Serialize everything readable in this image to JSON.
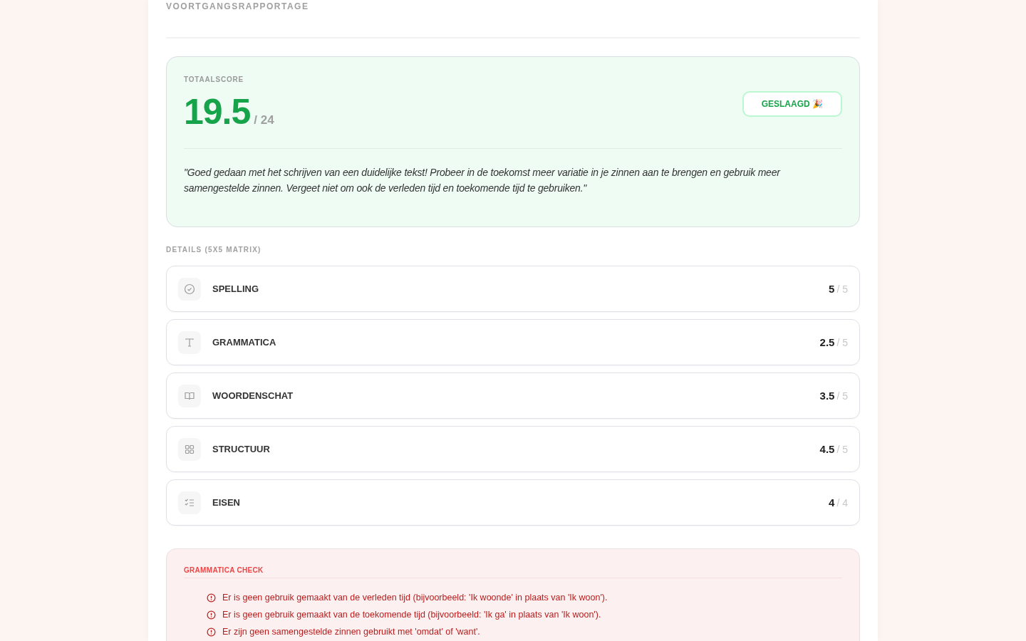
{
  "header": {
    "title": "VOORTGANGSRAPPORTAGE"
  },
  "total": {
    "label": "TOTAALSCORE",
    "score": "19.5",
    "max": "/ 24",
    "status": "GESLAAGD 🎉",
    "passed": true,
    "feedback": "\"Goed gedaan met het schrijven van een duidelijke tekst! Probeer in de toekomst meer variatie in je zinnen aan te brengen en gebruik meer samengestelde zinnen. Vergeet niet om ook de verleden tijd en toekomende tijd te gebruiken.\""
  },
  "details": {
    "heading": "DETAILS (5X5 MATRIX)",
    "items": [
      {
        "name": "SPELLING",
        "score": "5",
        "max": "/ 5"
      },
      {
        "name": "GRAMMATICA",
        "score": "2.5",
        "max": "/ 5"
      },
      {
        "name": "WOORDENSCHAT",
        "score": "3.5",
        "max": "/ 5"
      },
      {
        "name": "STRUCTUUR",
        "score": "4.5",
        "max": "/ 5"
      },
      {
        "name": "EISEN",
        "score": "4",
        "max": "/ 4"
      }
    ]
  },
  "grammar_check": {
    "heading": "GRAMMATICA CHECK",
    "issues": [
      "Er is geen gebruik gemaakt van de verleden tijd (bijvoorbeeld: 'Ik woonde' in plaats van 'Ik woon').",
      "Er is geen gebruik gemaakt van de toekomende tijd (bijvoorbeeld: 'Ik ga' in plaats van 'Ik woon').",
      "Er zijn geen samengestelde zinnen gebruikt met 'omdat' of 'want'."
    ]
  }
}
